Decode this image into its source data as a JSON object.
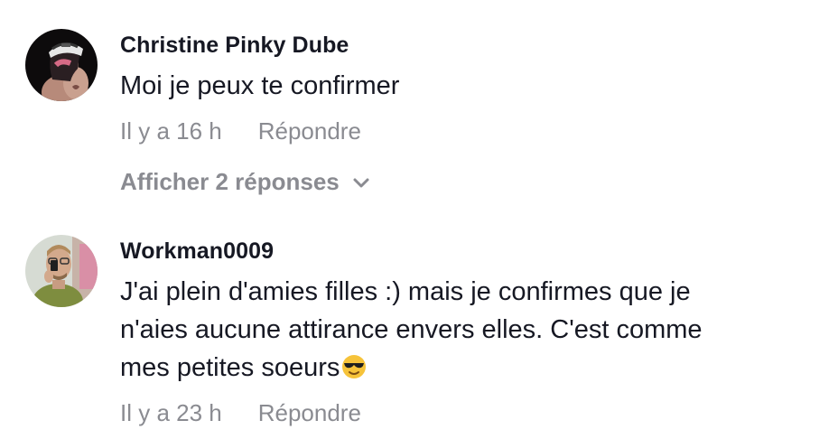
{
  "comments": [
    {
      "username": "Christine Pinky Dube",
      "text": "Moi je peux te confirmer",
      "time": "Il y a 16 h",
      "reply_label": "Répondre",
      "view_replies_label": "Afficher 2 réponses",
      "avatar_icon": "avatar-woman-cap"
    },
    {
      "username": "Workman0009",
      "text_lines": [
        "J'ai plein d'amies filles :) mais je confirmes que je",
        "n'aies aucune attirance envers elles. C'est comme",
        "mes petites soeurs"
      ],
      "emoji": "😎",
      "emoji_icon": "sunglasses-emoji-icon",
      "time": "Il y a 23 h",
      "reply_label": "Répondre",
      "avatar_icon": "avatar-man-selfie"
    }
  ],
  "colors": {
    "primary_text": "#161823",
    "secondary_text": "#8a8b91",
    "background": "#ffffff"
  }
}
